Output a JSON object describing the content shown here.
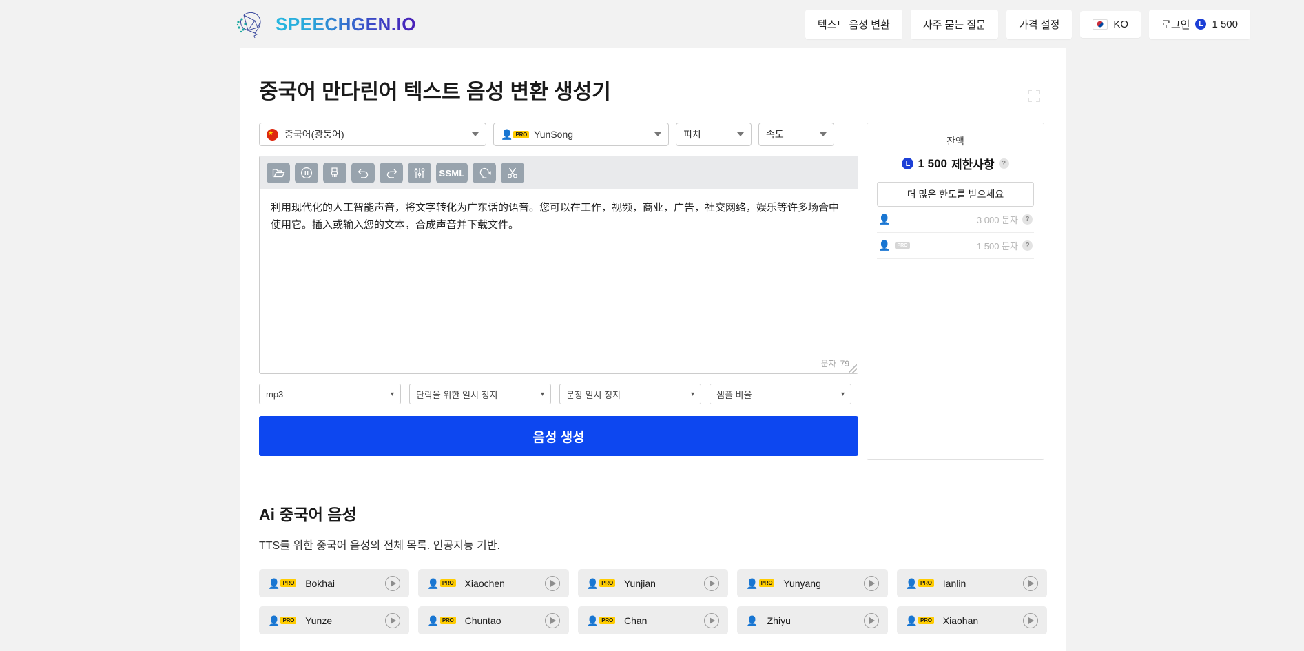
{
  "header": {
    "logo_text": "SPEECHGEN.IO",
    "logo_icon": "speechgen-network-head-logo",
    "nav": [
      {
        "label": "텍스트 음성 변환",
        "name": "nav-text-to-speech"
      },
      {
        "label": "자주 묻는 질문",
        "name": "nav-faq"
      },
      {
        "label": "가격 설정",
        "name": "nav-pricing"
      }
    ],
    "lang_label": "KO",
    "lang_flag": "kr-flag-icon",
    "login_label": "로그인",
    "login_credits": "1 500"
  },
  "main": {
    "title": "중국어 만다린어 텍스트 음성 변환 생성기",
    "expand_icon": "fullscreen-expand-icon",
    "selects": {
      "language": "중국어(광둥어)",
      "language_flag": "cn-flag-icon",
      "voice": "YunSong",
      "voice_badge": "PRO",
      "voice_gender": "male",
      "pitch": "피치",
      "speed": "속도"
    },
    "toolbar": [
      {
        "name": "open-file-icon",
        "label": "open"
      },
      {
        "name": "pause-icon",
        "label": "pause"
      },
      {
        "name": "clear-brush-icon",
        "label": "clear"
      },
      {
        "name": "undo-icon",
        "label": "undo"
      },
      {
        "name": "redo-icon",
        "label": "redo"
      },
      {
        "name": "equalizer-sliders-icon",
        "label": "settings"
      },
      {
        "name": "ssml-button",
        "label": "SSML"
      },
      {
        "name": "voice-head-icon",
        "label": "voice"
      },
      {
        "name": "scissors-icon",
        "label": "cut"
      }
    ],
    "textarea": {
      "value": "利用现代化的人工智能声音，将文字转化为广东话的语音。您可以在工作，视频，商业，广告，社交网络，娱乐等许多场合中使用它。插入或输入您的文本，合成声音并下载文件。",
      "counter_label": "문자",
      "counter_value": "79"
    },
    "options": {
      "format": "mp3",
      "paragraph_pause": "단락을 위한 일시 정지",
      "sentence_pause": "문장 일시 정지",
      "sample_rate": "샘플 비율"
    },
    "generate_label": "음성 생성",
    "generate_color": "#0d47f0"
  },
  "balance": {
    "title": "잔액",
    "amount": "1 500",
    "amount_suffix": "제한사항",
    "help": "?",
    "upgrade_label": "더 많은 한도를 받으세요",
    "rows": [
      {
        "icon": "person-icon",
        "badge": "",
        "value": "3 000 문자",
        "help": "?"
      },
      {
        "icon": "person-pro-icon",
        "badge": "PRO",
        "value": "1 500 문자",
        "help": "?"
      }
    ]
  },
  "voices": {
    "heading_prefix": "Ai",
    "heading": "중국어 음성",
    "heading_full": "Ai 중국어 음성",
    "subtitle": "TTS를 위한 중국어 음성의 전체 목록. 인공지능 기반.",
    "items": [
      {
        "name": "Bokhai",
        "gender": "male",
        "pro": true
      },
      {
        "name": "Xiaochen",
        "gender": "female",
        "pro": true
      },
      {
        "name": "Yunjian",
        "gender": "male",
        "pro": true
      },
      {
        "name": "Yunyang",
        "gender": "male",
        "pro": true
      },
      {
        "name": "Ianlin",
        "gender": "female",
        "pro": true
      },
      {
        "name": "Yunze",
        "gender": "male",
        "pro": true
      },
      {
        "name": "Chuntao",
        "gender": "female",
        "pro": true
      },
      {
        "name": "Chan",
        "gender": "male",
        "pro": true
      },
      {
        "name": "Zhiyu",
        "gender": "female",
        "pro": false
      },
      {
        "name": "Xiaohan",
        "gender": "female",
        "pro": true
      }
    ]
  }
}
